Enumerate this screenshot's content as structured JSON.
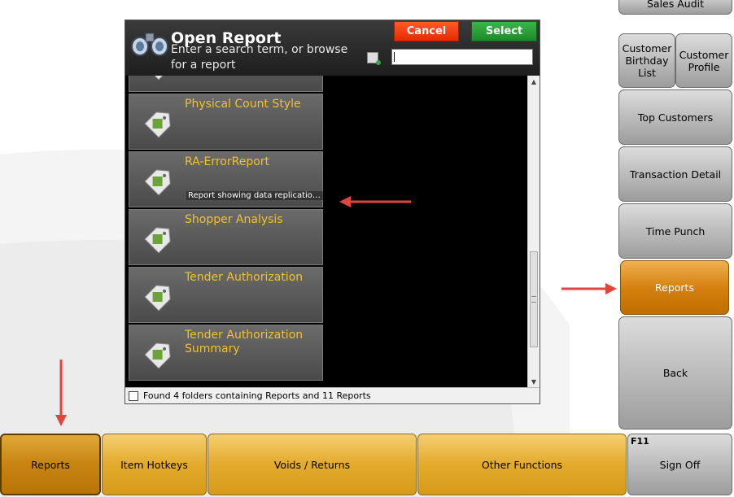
{
  "dialog": {
    "title": "Open Report",
    "subtitle": "Enter a search term, or browse for a report",
    "cancel_label": "Cancel",
    "select_label": "Select",
    "search_value": "",
    "status_text": "Found 4 folders containing Reports and 11 Reports",
    "reports": [
      {
        "title": "",
        "description": ""
      },
      {
        "title": "Physical Count Style",
        "description": ""
      },
      {
        "title": "RA-ErrorReport",
        "description": "Report showing data replication ..."
      },
      {
        "title": "Shopper Analysis",
        "description": ""
      },
      {
        "title": "Tender Authorization",
        "description": ""
      },
      {
        "title": "Tender Authorization Summary",
        "description": ""
      }
    ]
  },
  "side_menu": {
    "sales_audit": "Sales Audit",
    "customer_birthday_list": "Customer Birthday List",
    "customer_profile": "Customer Profile",
    "top_customers": "Top Customers",
    "transaction_detail": "Transaction Detail",
    "time_punch": "Time Punch",
    "reports": "Reports",
    "back": "Back"
  },
  "bottom_bar": {
    "reports": "Reports",
    "item_hotkeys": "Item Hotkeys",
    "voids_returns": "Voids / Returns",
    "other_functions": "Other Functions",
    "sign_off_fkey": "F11",
    "sign_off": "Sign Off"
  },
  "colors": {
    "report_title": "#f2c12e",
    "cancel": "#e42a00",
    "select": "#1d8a2a",
    "active_orange": "#d58110",
    "annotation_arrow": "#e0443c"
  }
}
